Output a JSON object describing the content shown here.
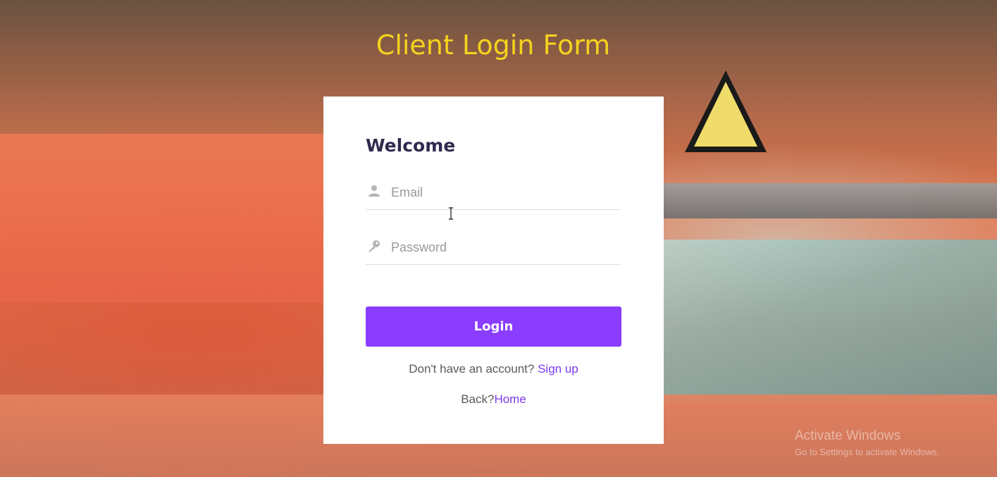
{
  "page": {
    "title": "Client Login Form"
  },
  "form": {
    "heading": "Welcome",
    "email": {
      "placeholder": "Email",
      "value": "",
      "icon": "user-icon"
    },
    "password": {
      "placeholder": "Password",
      "value": "",
      "icon": "key-icon"
    },
    "login_label": "Login",
    "signup_prompt": "Don't have an account?",
    "signup_link": "Sign up",
    "back_prompt": "Back?",
    "home_link": "Home"
  },
  "watermark": {
    "line1": "Activate Windows",
    "line2": "Go to Settings to activate Windows."
  },
  "colors": {
    "title": "#f5d21e",
    "accent": "#8a3dff",
    "link": "#7c3aed",
    "heading": "#2e2a4f"
  }
}
